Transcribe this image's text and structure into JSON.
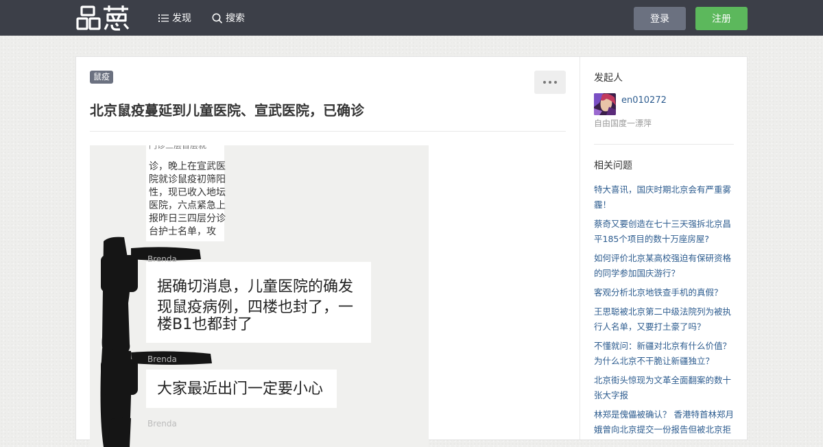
{
  "header": {
    "logo_text": "品葱",
    "nav": [
      {
        "label": "发现",
        "icon": "list-icon"
      },
      {
        "label": "搜索",
        "icon": "search-icon"
      }
    ],
    "login_label": "登录",
    "register_label": "注册",
    "colors": {
      "bar": "#3c3f48",
      "login": "#6b7180",
      "register": "#5cb85c"
    }
  },
  "question": {
    "tag": "鼠疫",
    "title": "北京鼠疫蔓延到儿童医院、宣武医院，已确诊",
    "image": {
      "top_text_lines": [
        "诊，晚上在宣武医",
        "院就诊鼠疫初筛阳",
        "性，现已收入地坛",
        "医院，六点紧急上",
        "报昨日三四层分诊",
        "台护士名单，攻"
      ],
      "bubble1_lines": [
        "据确切消息，儿童医院的确发",
        "现鼠疫病例，四楼也封了，一",
        "楼B1也都封了"
      ],
      "bubble2": "大家最近出门一定要小心"
    }
  },
  "sidebar": {
    "initiator_heading": "发起人",
    "user": {
      "name": "en010272",
      "description": "自由国度一漂萍"
    },
    "related_heading": "相关问题",
    "related": [
      "特大喜讯，国庆时期北京会有严重雾霾！",
      "蔡奇又要创造在七十三天强拆北京昌平185个项目的数十万座房屋?",
      "如何评价北京某高校强迫有保研资格的同学参加国庆游行？",
      "客观分析北京地铁查手机的真假？",
      "王思聪被北京第二中级法院列为被执行人名单，又要打土豪了吗？",
      "不懂就问：新疆对北京有什么价值？为什么北京不干脆让新疆独立？",
      "北京街头惊现为文革全面翻案的数十张大字报",
      "林郑是傀儡被确认？ 香港特首林郑月娥曾向北京提交一份报告但被北京拒"
    ]
  }
}
